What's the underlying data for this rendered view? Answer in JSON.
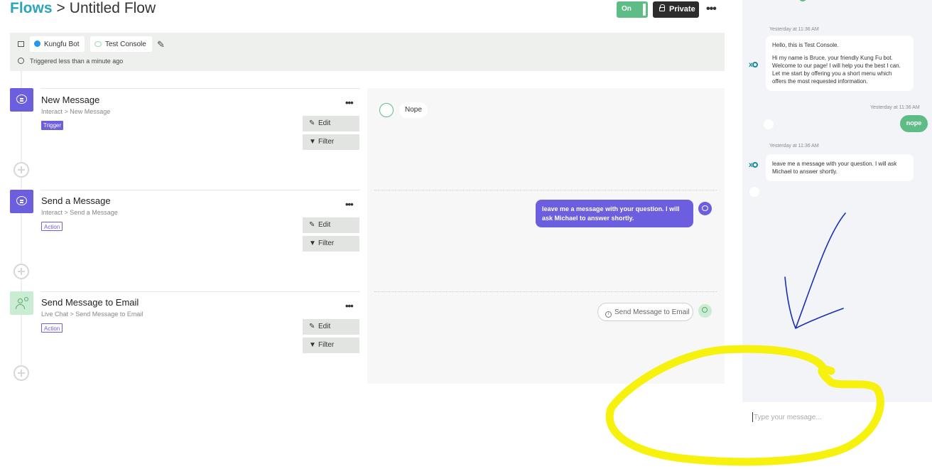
{
  "header": {
    "breadcrumb_root": "Flows",
    "separator": ">",
    "flow_name": "Untitled Flow",
    "toggle_label": "On",
    "privacy_label": "Private",
    "more_label": "•••"
  },
  "meta": {
    "channel_label": "Kungfu Bot",
    "console_label": "Test Console",
    "triggered_text": "Triggered less than a minute ago"
  },
  "steps": [
    {
      "title": "New Message",
      "subtitle": "Interact > New Message",
      "badge": "Trigger",
      "edit_label": "Edit",
      "filter_label": "Filter"
    },
    {
      "title": "Send a Message",
      "subtitle": "Interact > Send a Message",
      "badge": "Action",
      "edit_label": "Edit",
      "filter_label": "Filter"
    },
    {
      "title": "Send Message to Email",
      "subtitle": "Live Chat > Send Message to Email",
      "badge": "Action",
      "edit_label": "Edit",
      "filter_label": "Filter"
    }
  ],
  "preview": {
    "incoming_text": "Nope",
    "bot_reply": "leave me a message with your question. I will ask Michael to answer shortly.",
    "email_action": "Send Message to Email"
  },
  "chat": {
    "messages": [
      {
        "timestamp": "Yesterday at 11:36 AM",
        "text_line1": "Hello, this is Test Console.",
        "text_line2": "Hi my name is Bruce, your friendly Kung Fu bot. Welcome to our page! I will help you the best I can. Let me start by offering you a short menu which offers the most requested information."
      },
      {
        "timestamp": "Yesterday at 11:36 AM",
        "user_text": "nope"
      },
      {
        "timestamp": "Yesterday at 11:36 AM",
        "text": "leave me a message with your question. I will ask Michael to answer shortly."
      }
    ],
    "input_placeholder": "Type your message...",
    "bot_logo": "x"
  },
  "colors": {
    "brand_teal": "#2aa6b8",
    "accent_purple": "#6b5fe0",
    "accent_green": "#5ebc87",
    "annotation_yellow": "#f6f000",
    "annotation_blue": "#1a2fb8"
  },
  "icons": [
    "pin-icon",
    "messenger-icon",
    "chat-bubble-icon",
    "pencil-icon",
    "clock-icon",
    "lock-icon",
    "more-icon",
    "filter-icon",
    "info-icon",
    "plus-circle-icon",
    "person-settings-icon"
  ]
}
